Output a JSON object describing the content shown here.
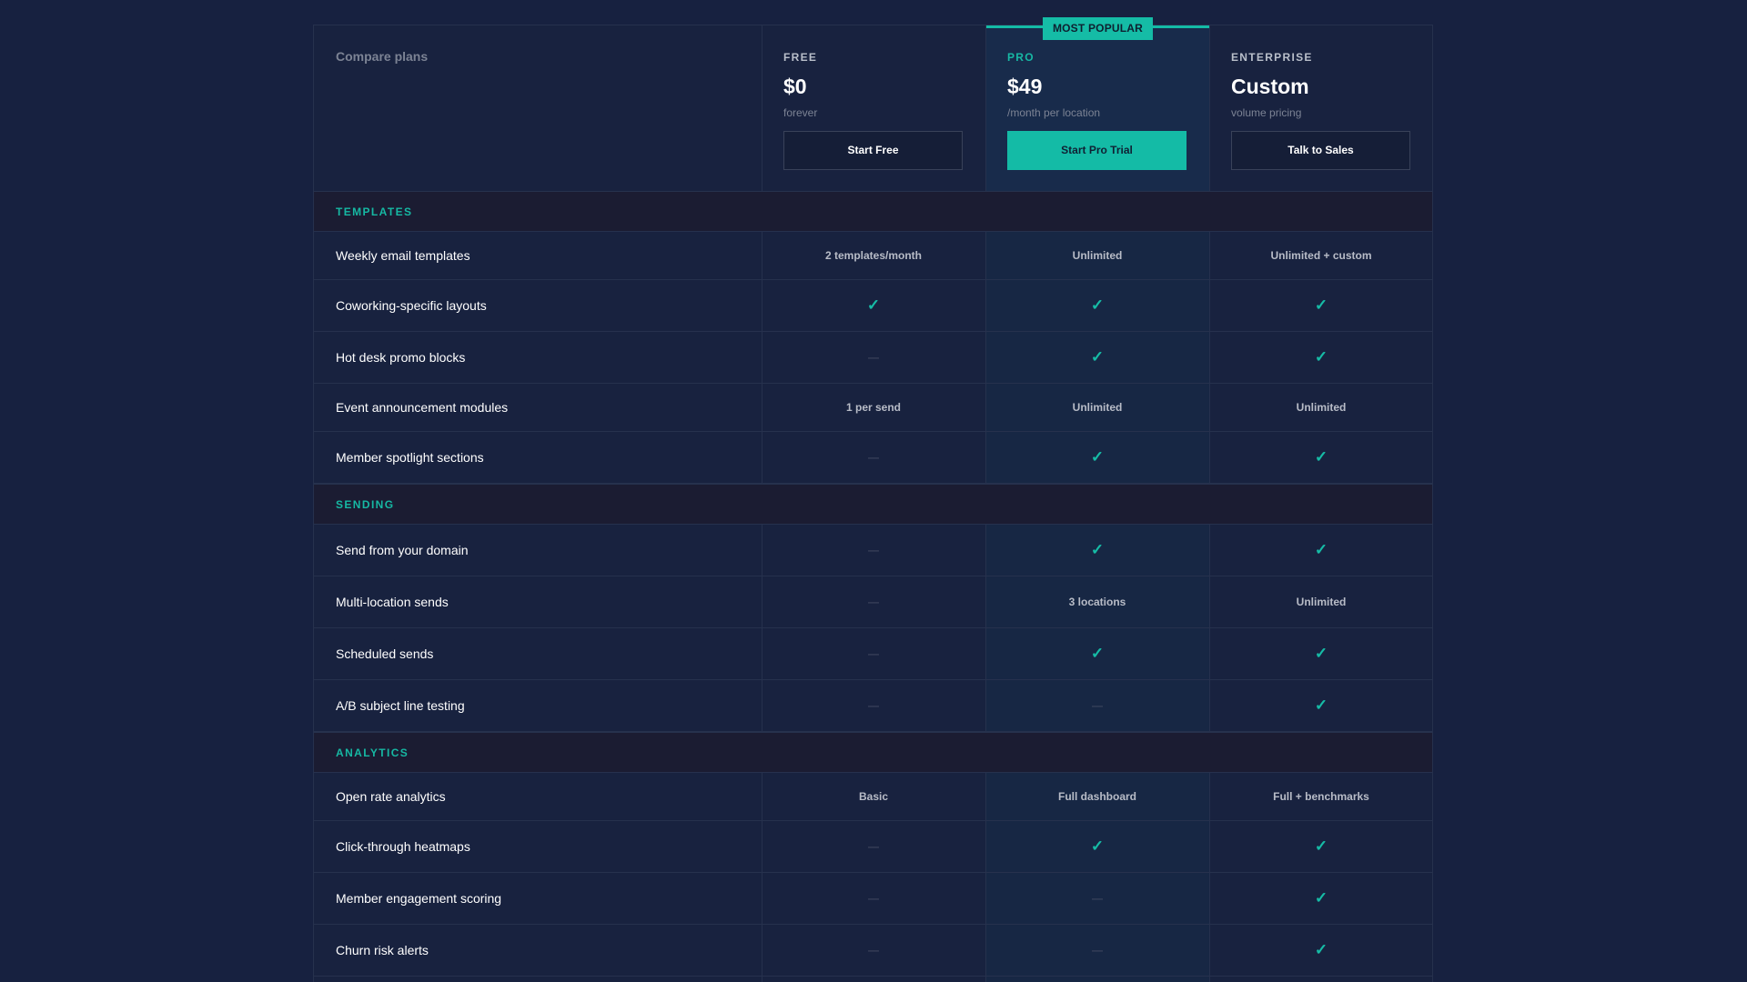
{
  "compare_title": "Compare plans",
  "badge": "MOST POPULAR",
  "plans": [
    {
      "name": "FREE",
      "price": "$0",
      "period": "forever",
      "button": "Start Free"
    },
    {
      "name": "PRO",
      "price": "$49",
      "period": "/month per location",
      "button": "Start Pro Trial"
    },
    {
      "name": "ENTERPRISE",
      "price": "Custom",
      "period": "volume pricing",
      "button": "Talk to Sales"
    }
  ],
  "sections": [
    {
      "title": "TEMPLATES",
      "rows": [
        {
          "feature": "Weekly email templates",
          "free": "2 templates/month",
          "pro": "Unlimited",
          "enterprise": "Unlimited + custom"
        },
        {
          "feature": "Coworking-specific layouts",
          "free": "✓",
          "pro": "✓",
          "enterprise": "✓"
        },
        {
          "feature": "Hot desk promo blocks",
          "free": "—",
          "pro": "✓",
          "enterprise": "✓"
        },
        {
          "feature": "Event announcement modules",
          "free": "1 per send",
          "pro": "Unlimited",
          "enterprise": "Unlimited"
        },
        {
          "feature": "Member spotlight sections",
          "free": "—",
          "pro": "✓",
          "enterprise": "✓"
        }
      ]
    },
    {
      "title": "SENDING",
      "rows": [
        {
          "feature": "Send from your domain",
          "free": "—",
          "pro": "✓",
          "enterprise": "✓"
        },
        {
          "feature": "Multi-location sends",
          "free": "—",
          "pro": "3 locations",
          "enterprise": "Unlimited"
        },
        {
          "feature": "Scheduled sends",
          "free": "—",
          "pro": "✓",
          "enterprise": "✓"
        },
        {
          "feature": "A/B subject line testing",
          "free": "—",
          "pro": "—",
          "enterprise": "✓"
        }
      ]
    },
    {
      "title": "ANALYTICS",
      "rows": [
        {
          "feature": "Open rate analytics",
          "free": "Basic",
          "pro": "Full dashboard",
          "enterprise": "Full + benchmarks"
        },
        {
          "feature": "Click-through heatmaps",
          "free": "—",
          "pro": "✓",
          "enterprise": "✓"
        },
        {
          "feature": "Member engagement scoring",
          "free": "—",
          "pro": "—",
          "enterprise": "✓"
        },
        {
          "feature": "Churn risk alerts",
          "free": "—",
          "pro": "—",
          "enterprise": "✓"
        }
      ]
    }
  ],
  "colors": {
    "background": "#172140",
    "accent": "#14bba6",
    "section_background": "#1b1c32"
  }
}
